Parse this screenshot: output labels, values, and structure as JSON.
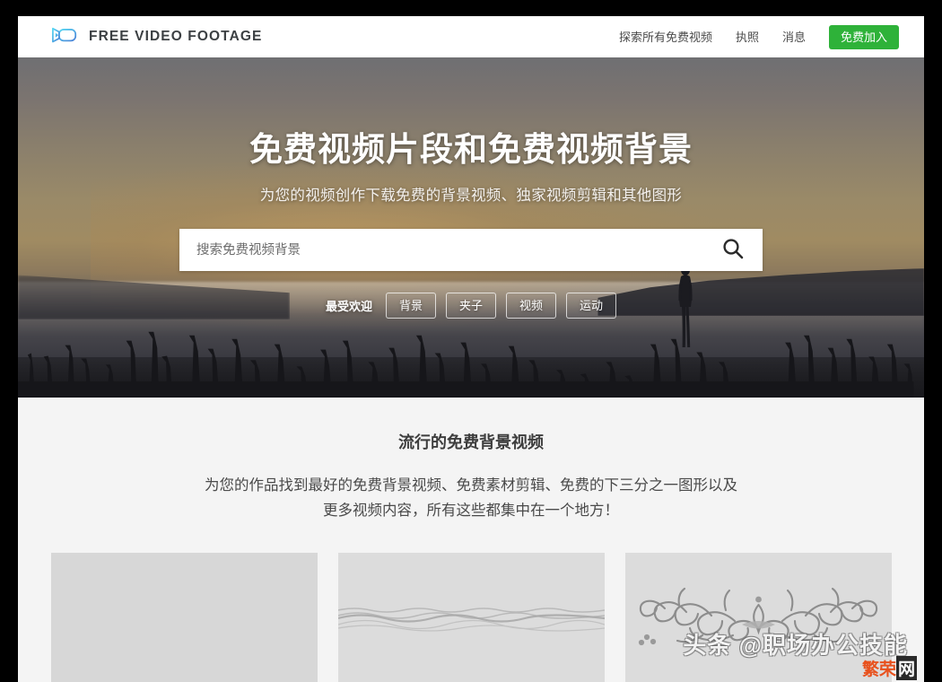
{
  "header": {
    "brand_name": "FREE VIDEO FOOTAGE",
    "brand_icon": "video-camera-icon",
    "nav": [
      {
        "label": "探索所有免费视频",
        "name": "nav-explore"
      },
      {
        "label": "执照",
        "name": "nav-license"
      },
      {
        "label": "消息",
        "name": "nav-news"
      }
    ],
    "cta_label": "免费加入",
    "cta_color": "#2eb239"
  },
  "hero": {
    "title": "免费视频片段和免费视频背景",
    "subtitle": "为您的视频创作下载免费的背景视频、独家视频剪辑和其他图形",
    "search": {
      "placeholder": "搜索免费视频背景",
      "value": "",
      "button_icon": "search-icon"
    },
    "tags_label": "最受欢迎",
    "tags": [
      {
        "label": "背景",
        "name": "tag-background"
      },
      {
        "label": "夹子",
        "name": "tag-clip"
      },
      {
        "label": "视频",
        "name": "tag-video"
      },
      {
        "label": "运动",
        "name": "tag-motion"
      }
    ]
  },
  "popular": {
    "title": "流行的免费背景视频",
    "description_line1": "为您的作品找到最好的免费背景视频、免费素材剪辑、免费的下三分之一图形以及",
    "description_line2": "更多视频内容，所有这些都集中在一个地方！",
    "cards": [
      {
        "name": "video-card-blank",
        "art": "plain"
      },
      {
        "name": "video-card-waves",
        "art": "waves"
      },
      {
        "name": "video-card-ornament",
        "art": "ornament"
      }
    ]
  },
  "watermark": {
    "headline": "头条 @职场办公技能",
    "site_orange": "繁荣",
    "site_box": "网"
  }
}
